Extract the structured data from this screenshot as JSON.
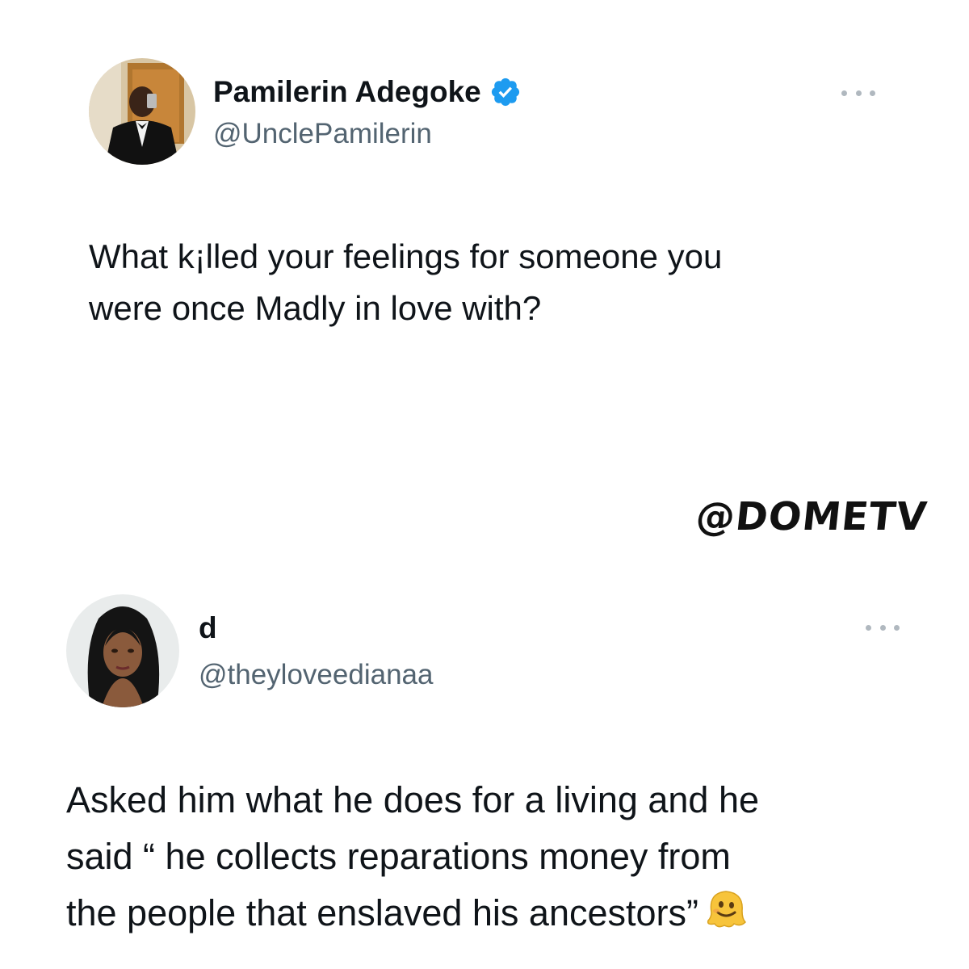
{
  "tweets": [
    {
      "display_name": "Pamilerin Adegoke",
      "handle": "@UnclePamilerin",
      "verified": true,
      "text_lines": [
        "What k¡lled your feelings for someone you",
        "were once Madly in love with?"
      ]
    },
    {
      "display_name": "d",
      "handle": "@theyloveedianaa",
      "verified": false,
      "text_lines": [
        "Asked him what he does for a living and he",
        "said “ he collects reparations money from",
        "the people that enslaved his ancestors”"
      ],
      "emoji": "melting-face-icon"
    }
  ],
  "watermark": "@DOMETV",
  "colors": {
    "verified_blue": "#1d9bf0",
    "handle_gray": "#536471",
    "text": "#0f1419",
    "more_dots": "#b0b8bf"
  }
}
